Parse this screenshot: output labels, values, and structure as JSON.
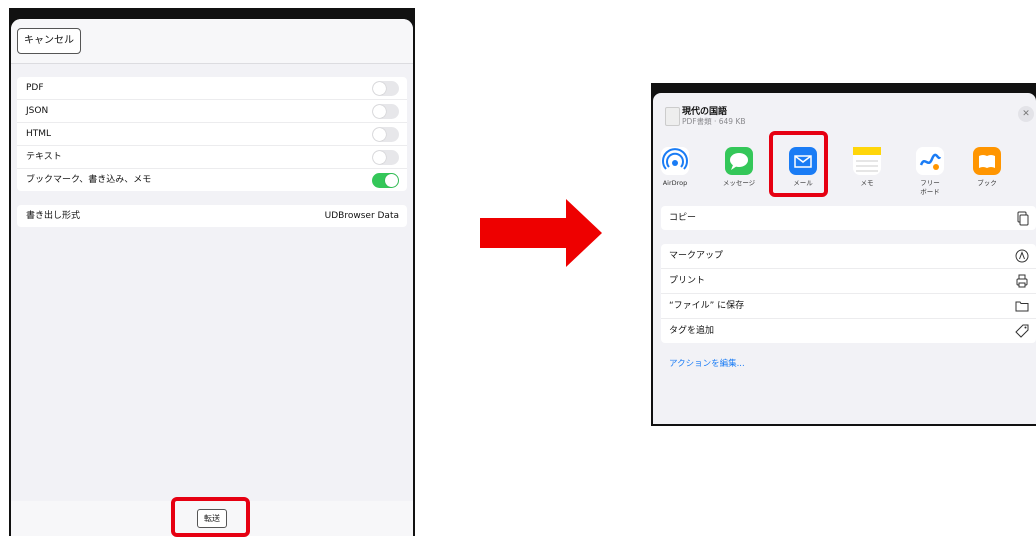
{
  "left": {
    "cancel_label": "キャンセル",
    "toggles": [
      {
        "label": "PDF",
        "on": false
      },
      {
        "label": "JSON",
        "on": false
      },
      {
        "label": "HTML",
        "on": false
      },
      {
        "label": "テキスト",
        "on": false
      },
      {
        "label": "ブックマーク、書き込み、メモ",
        "on": true
      }
    ],
    "export_format": {
      "label": "書き出し形式",
      "value": "UDBrowser Data"
    },
    "send_label": "転送"
  },
  "right": {
    "doc": {
      "title": "現代の国語",
      "subtitle": "PDF書類 · 649 KB"
    },
    "apps": [
      {
        "label": "AirDrop",
        "icon": "airdrop-icon"
      },
      {
        "label": "メッセージ",
        "icon": "messages-icon"
      },
      {
        "label": "メール",
        "icon": "mail-icon"
      },
      {
        "label": "メモ",
        "icon": "notes-icon"
      },
      {
        "label": "フリー\nボード",
        "icon": "freeform-icon"
      },
      {
        "label": "ブック",
        "icon": "books-icon"
      }
    ],
    "copy_label": "コピー",
    "actions": [
      {
        "label": "マークアップ",
        "icon": "markup-icon"
      },
      {
        "label": "プリント",
        "icon": "print-icon"
      },
      {
        "label": "“ファイル” に保存",
        "icon": "folder-icon"
      },
      {
        "label": "タグを追加",
        "icon": "tag-icon"
      }
    ],
    "edit_actions_label": "アクションを編集..."
  },
  "colors": {
    "highlight": "#e60012",
    "toggle_on": "#34c759",
    "link": "#1a7cf5"
  }
}
